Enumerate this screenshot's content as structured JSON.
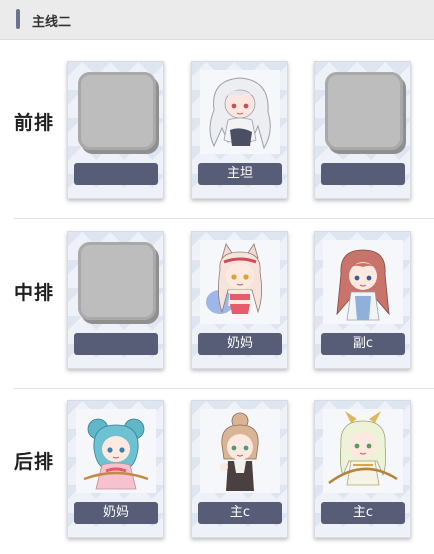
{
  "header": {
    "title": "主线二"
  },
  "rows": [
    {
      "label": "前排",
      "slots": [
        {
          "empty": true,
          "role": ""
        },
        {
          "empty": false,
          "role": "主坦",
          "portrait": "white-hair-girl"
        },
        {
          "empty": true,
          "role": ""
        }
      ]
    },
    {
      "label": "中排",
      "slots": [
        {
          "empty": true,
          "role": ""
        },
        {
          "empty": false,
          "role": "奶妈",
          "portrait": "cat-ear-swimsuit-girl"
        },
        {
          "empty": false,
          "role": "副c",
          "portrait": "brown-hair-girl"
        }
      ]
    },
    {
      "label": "后排",
      "slots": [
        {
          "empty": false,
          "role": "奶妈",
          "portrait": "teal-bun-girl"
        },
        {
          "empty": false,
          "role": "主c",
          "portrait": "tan-hair-girl"
        },
        {
          "empty": false,
          "role": "主c",
          "portrait": "archer-girl"
        }
      ]
    }
  ],
  "colors": {
    "tag_bg": "#575c77",
    "header_accent": "#6b7390",
    "empty_slot": "#bdbdbd"
  }
}
